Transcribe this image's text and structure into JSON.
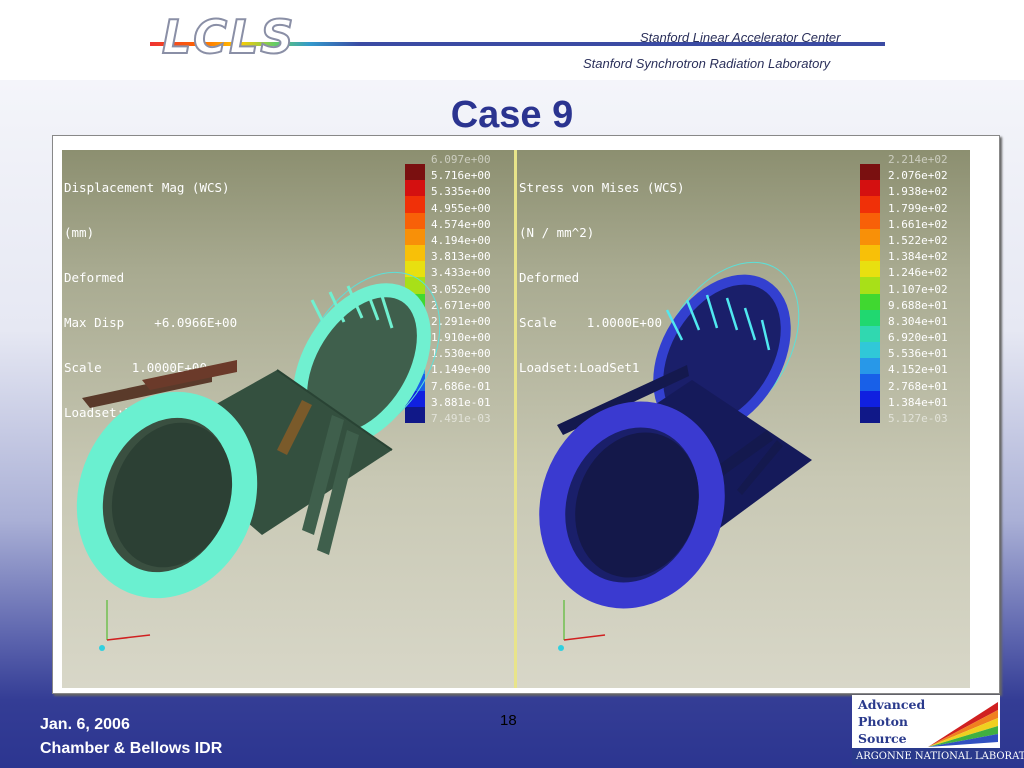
{
  "header": {
    "logo_text": "LCLS",
    "org_line1": "Stanford Linear Accelerator Center",
    "org_line2": "Stanford Synchrotron Radiation Laboratory"
  },
  "slide": {
    "title": "Case 9",
    "page_number": "18"
  },
  "left_panel": {
    "info": [
      "Displacement Mag (WCS)",
      "(mm)",
      "Deformed",
      "Max Disp    +6.0966E+00",
      "Scale    1.0000E+00",
      "Loadset:LoadSet1"
    ],
    "legend_ticks": [
      "6.097e+00",
      "5.716e+00",
      "5.335e+00",
      "4.955e+00",
      "4.574e+00",
      "4.194e+00",
      "3.813e+00",
      "3.433e+00",
      "3.052e+00",
      "2.671e+00",
      "2.291e+00",
      "1.910e+00",
      "1.530e+00",
      "1.149e+00",
      "7.686e-01",
      "3.881e-01",
      "7.491e-03"
    ]
  },
  "right_panel": {
    "info": [
      "Stress von Mises (WCS)",
      "(N / mm^2)",
      "Deformed",
      "Scale    1.0000E+00",
      "Loadset:LoadSet1"
    ],
    "legend_ticks": [
      "2.214e+02",
      "2.076e+02",
      "1.938e+02",
      "1.799e+02",
      "1.661e+02",
      "1.522e+02",
      "1.384e+02",
      "1.246e+02",
      "1.107e+02",
      "9.688e+01",
      "8.304e+01",
      "6.920e+01",
      "5.536e+01",
      "4.152e+01",
      "2.768e+01",
      "1.384e+01",
      "5.127e-03"
    ]
  },
  "colors": {
    "title": "#2b3490",
    "colorbar": [
      "#7a1010",
      "#d41010",
      "#f03008",
      "#f86008",
      "#f89008",
      "#f8c008",
      "#e8e010",
      "#a8e018",
      "#40d830",
      "#20d870",
      "#30d8b0",
      "#30c8d8",
      "#2898e8",
      "#1860e8",
      "#1020e0",
      "#101888"
    ]
  },
  "footer": {
    "date": "Jan. 6, 2006",
    "subtitle": "Chamber & Bellows IDR"
  },
  "aps_logo": {
    "line1": "Advanced",
    "line2": "Photon",
    "line3": "Source",
    "lab": "ARGONNE NATIONAL LABORATORY"
  }
}
